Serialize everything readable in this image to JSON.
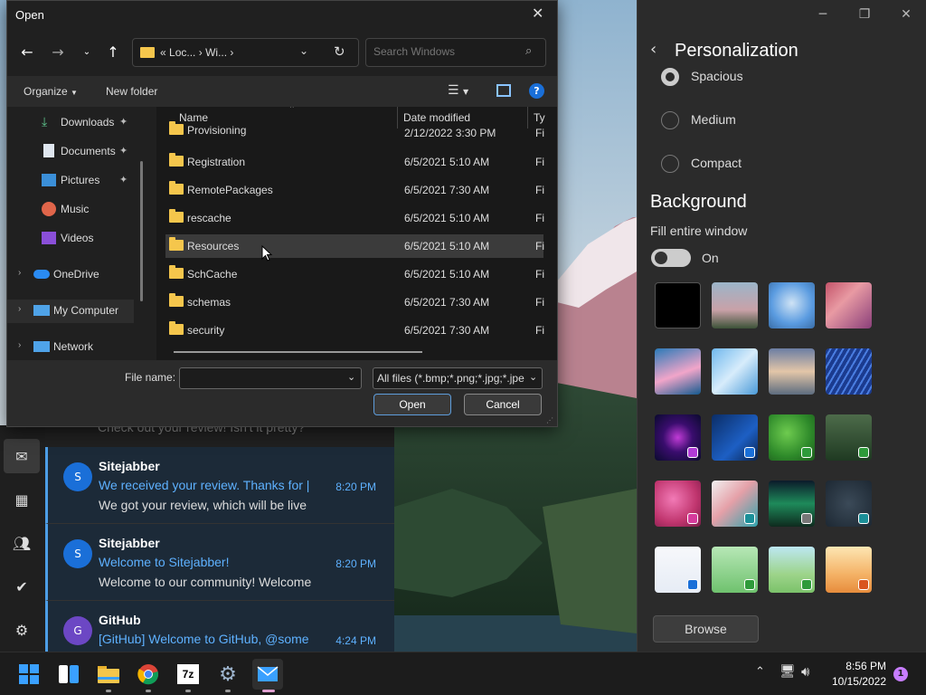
{
  "dialog": {
    "title": "Open",
    "address_parts": [
      "«",
      "Loc...",
      "›",
      "Wi...",
      "›"
    ],
    "search_placeholder": "Search Windows",
    "toolbar": {
      "organize": "Organize",
      "new_folder": "New folder"
    },
    "nav_items": [
      {
        "label": "Downloads",
        "icon": "download-icon",
        "pinned": true
      },
      {
        "label": "Documents",
        "icon": "document-icon",
        "pinned": true
      },
      {
        "label": "Pictures",
        "icon": "pictures-icon",
        "pinned": true
      },
      {
        "label": "Music",
        "icon": "music-icon",
        "pinned": false
      },
      {
        "label": "Videos",
        "icon": "videos-icon",
        "pinned": false
      },
      {
        "label": "OneDrive",
        "icon": "cloud-icon",
        "pinned": false
      },
      {
        "label": "My Computer",
        "icon": "computer-icon",
        "pinned": false
      },
      {
        "label": "Network",
        "icon": "network-icon",
        "pinned": false
      }
    ],
    "columns": {
      "name": "Name",
      "date": "Date modified",
      "type": "Ty"
    },
    "files": [
      {
        "name": "Provisioning",
        "date": "2/12/2022 3:30 PM",
        "type": "Fi"
      },
      {
        "name": "Registration",
        "date": "6/5/2021 5:10 AM",
        "type": "Fi"
      },
      {
        "name": "RemotePackages",
        "date": "6/5/2021 7:30 AM",
        "type": "Fi"
      },
      {
        "name": "rescache",
        "date": "6/5/2021 5:10 AM",
        "type": "Fi"
      },
      {
        "name": "Resources",
        "date": "6/5/2021 5:10 AM",
        "type": "Fi"
      },
      {
        "name": "SchCache",
        "date": "6/5/2021 5:10 AM",
        "type": "Fi"
      },
      {
        "name": "schemas",
        "date": "6/5/2021 7:30 AM",
        "type": "Fi"
      },
      {
        "name": "security",
        "date": "6/5/2021 7:30 AM",
        "type": "Fi"
      }
    ],
    "file_name_label": "File name:",
    "file_name_value": "",
    "filter": "All files (*.bmp;*.png;*.jpg;*.jpe",
    "open_button": "Open",
    "cancel_button": "Cancel"
  },
  "mail": {
    "partial_preview": "Check out your review! Isn't it pretty?",
    "messages": [
      {
        "from": "Sitejabber",
        "initial": "S",
        "subject": "We received your review. Thanks for |",
        "time": "8:20 PM",
        "preview": "We got your review, which will be live",
        "avatar_color": "#1a6fd8"
      },
      {
        "from": "Sitejabber",
        "initial": "S",
        "subject": "Welcome to Sitejabber!",
        "time": "8:20 PM",
        "preview": "Welcome to our community! Welcome",
        "avatar_color": "#1a6fd8"
      },
      {
        "from": "GitHub",
        "initial": "G",
        "subject": "[GitHub] Welcome to GitHub, @some",
        "time": "4:24 PM",
        "preview": "",
        "avatar_color": "#6c47c4"
      }
    ]
  },
  "settings": {
    "title": "Personalization",
    "density": {
      "options": [
        "Spacious",
        "Medium",
        "Compact"
      ],
      "selected": "Spacious"
    },
    "background_heading": "Background",
    "fill_label": "Fill entire window",
    "toggle_state": "On",
    "toggle_on": true,
    "browse_button": "Browse"
  },
  "taskbar": {
    "time": "8:56 PM",
    "date": "10/15/2022",
    "notification_count": "1",
    "apps": [
      "start-icon",
      "widgets-icon",
      "file-explorer-icon",
      "chrome-icon",
      "7zip-icon",
      "settings-icon",
      "mail-icon"
    ],
    "sevenzip_label": "7z"
  },
  "colors": {
    "accent": "#4d9ee6",
    "link_blue": "#5eb1ff",
    "folder": "#f5c64c",
    "notification": "#c77dff"
  }
}
